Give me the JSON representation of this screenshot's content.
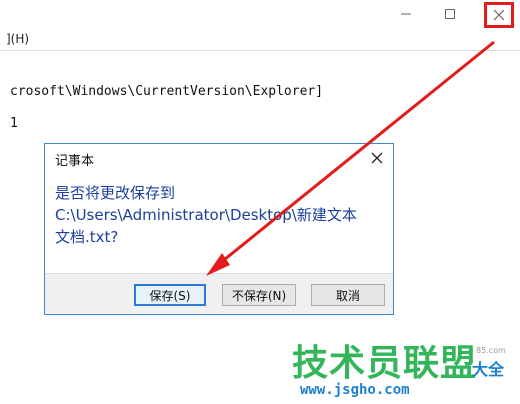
{
  "window": {
    "minimize_icon": "minimize-icon",
    "maximize_icon": "maximize-icon",
    "close_icon": "close-icon",
    "close_highlight_color": "#e21b1b"
  },
  "menu": {
    "help_label": "](H)"
  },
  "editor": {
    "lines": [
      "crosoft\\Windows\\CurrentVersion\\Explorer]",
      "1"
    ]
  },
  "dialog": {
    "title": "记事本",
    "message_line1": "是否将更改保存到",
    "message_line2": "C:\\Users\\Administrator\\Desktop\\新建文本",
    "message_line3": "文档.txt?",
    "buttons": {
      "save": "保存(S)",
      "dont_save": "不保存(N)",
      "cancel": "取消"
    },
    "border_color": "#3a87d8",
    "message_color": "#1a3f9c"
  },
  "annotation": {
    "arrow_color": "#e21b1b"
  },
  "watermark": {
    "main_text": "技术员联盟",
    "side_text": "大全",
    "url": "www.jsgho.com",
    "small_text": "85.com"
  }
}
